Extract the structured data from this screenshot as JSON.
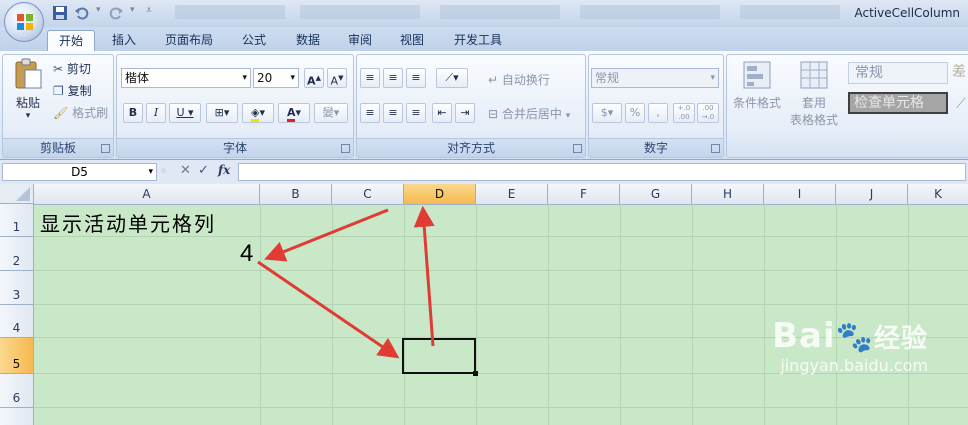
{
  "title_bar": {
    "app_title": "ActiveCellColumn"
  },
  "tabs": [
    {
      "label": "开始",
      "active": true
    },
    {
      "label": "插入"
    },
    {
      "label": "页面布局"
    },
    {
      "label": "公式"
    },
    {
      "label": "数据"
    },
    {
      "label": "审阅"
    },
    {
      "label": "视图"
    },
    {
      "label": "开发工具"
    }
  ],
  "ribbon": {
    "clipboard": {
      "title": "剪贴板",
      "paste": "粘贴",
      "cut": "剪切",
      "copy": "复制",
      "format_painter": "格式刷"
    },
    "font": {
      "title": "字体",
      "font_name": "楷体",
      "font_size": "20",
      "bold": "B",
      "italic": "I",
      "underline": "U",
      "font_color_letter": "A",
      "phonetic": "變"
    },
    "alignment": {
      "title": "对齐方式",
      "wrap_text": "自动换行",
      "merge_center": "合并后居中"
    },
    "number": {
      "title": "数字",
      "format": "常规",
      "percent": "%",
      "comma": ",",
      "inc_decimal": "+.0 .00",
      "dec_decimal": ".00 →.0"
    },
    "styles": {
      "conditional_format": "条件格式",
      "table_format_1": "套用",
      "table_format_2": "表格格式",
      "style_normal": "常规",
      "style_check_cell": "检查单元格",
      "style_partial": "差"
    }
  },
  "formula_bar": {
    "name_box": "D5",
    "fx": "fx",
    "value": ""
  },
  "grid": {
    "columns": [
      "A",
      "B",
      "C",
      "D",
      "E",
      "F",
      "G",
      "H",
      "I",
      "J",
      "K"
    ],
    "selected_column": "D",
    "rows": [
      "1",
      "2",
      "3",
      "4",
      "5",
      "6"
    ],
    "selected_row": "5",
    "cells": {
      "A1": "显示活动单元格列",
      "A2": "4"
    }
  },
  "watermark": {
    "brand": "Bai",
    "brand2": "经验",
    "url": "jingyan.baidu.com"
  },
  "colors": {
    "sheet_bg": "#c8e8c8",
    "arrow": "#e03c35",
    "selected_header": "#f6b94f"
  }
}
